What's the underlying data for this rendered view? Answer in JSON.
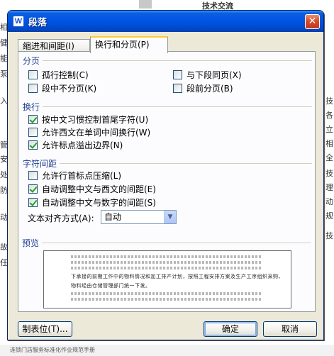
{
  "background": {
    "top_text": "技术交流",
    "left_fragments": [
      "相",
      "健",
      "能",
      "泵",
      "入",
      "管",
      "安",
      "处",
      "防",
      "动",
      "故",
      "任"
    ],
    "right_fragments": [
      "技",
      "各",
      "立",
      "相",
      "全",
      "技",
      "理",
      "动",
      "规",
      "技"
    ],
    "footer_text": "连锁门店服务标准化作业规范手册"
  },
  "dialog": {
    "title": "段落",
    "app_icon": "W",
    "close_symbol": "✕",
    "tabs": [
      {
        "label": "缩进和间距(I)",
        "active": false
      },
      {
        "label": "换行和分页(P)",
        "active": true
      }
    ],
    "sections": {
      "pagination": {
        "title": "分页",
        "options": [
          {
            "label": "孤行控制(C)",
            "checked": false
          },
          {
            "label": "与下段同页(X)",
            "checked": false
          },
          {
            "label": "段中不分页(K)",
            "checked": false
          },
          {
            "label": "段前分页(B)",
            "checked": false
          }
        ]
      },
      "line_break": {
        "title": "换行",
        "options": [
          {
            "label": "按中文习惯控制首尾字符(U)",
            "checked": true
          },
          {
            "label": "允许西文在单词中间换行(W)",
            "checked": false
          },
          {
            "label": "允许标点溢出边界(N)",
            "checked": true
          }
        ]
      },
      "char_spacing": {
        "title": "字符间距",
        "options": [
          {
            "label": "允许行首标点压缩(L)",
            "checked": false
          },
          {
            "label": "自动调整中文与西文的间距(E)",
            "checked": true
          },
          {
            "label": "自动调整中文与数字的间距(S)",
            "checked": true
          }
        ]
      },
      "text_align": {
        "label": "文本对齐方式(A):",
        "value": "自动",
        "arrow": "▼"
      },
      "preview": {
        "title": "预览",
        "sample_line_1": "下承接的前期工作中的物料情况和加工排产计划，按照工程安排方案及生产工序组织采购、",
        "sample_line_2": "物料经由仓储管理部门统一下发。"
      }
    },
    "buttons": {
      "tabs": "制表位(T)...",
      "ok": "确定",
      "cancel": "取消"
    }
  },
  "colors": {
    "dialog_bg": "#ece9d8",
    "titlebar": "#0054e3",
    "section_title": "#1f3f8f",
    "check_mark": "#21a121",
    "tab_highlight": "#ffc83c"
  }
}
